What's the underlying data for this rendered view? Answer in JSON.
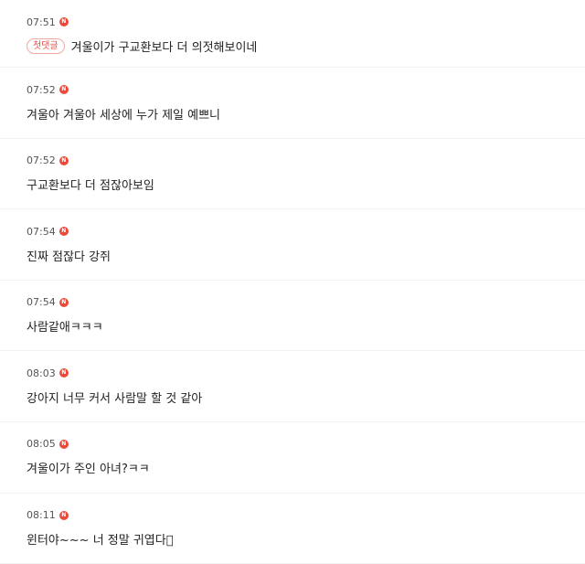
{
  "new_badge_label": "N",
  "first_comment_badge": "첫댓글",
  "colors": {
    "new_badge": "#ea4a3c",
    "first_badge_text": "#e2524a",
    "first_badge_border": "#f0a9a3"
  },
  "comments": [
    {
      "time": "07:51",
      "text": "겨울이가 구교환보다 더 의젓해보이네"
    },
    {
      "time": "07:52",
      "text": "겨울아 겨울아 세상에 누가 제일 예쁘니"
    },
    {
      "time": "07:52",
      "text": "구교환보다 더 점잖아보임"
    },
    {
      "time": "07:54",
      "text": "진짜 점잖다 강쥐"
    },
    {
      "time": "07:54",
      "text": "사람같애ㅋㅋㅋ"
    },
    {
      "time": "08:03",
      "text": "강아지 너무 커서 사람말 할 것 같아"
    },
    {
      "time": "08:05",
      "text": "겨울이가 주인 아녀?ㅋㅋ"
    },
    {
      "time": "08:11",
      "text": "윈터야~~~ 너 정말 귀엽다􀀀"
    }
  ]
}
